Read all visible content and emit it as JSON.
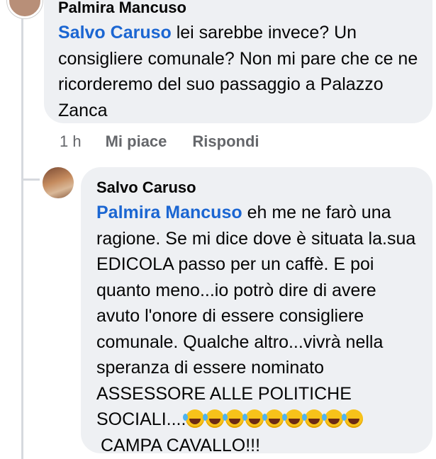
{
  "comment1": {
    "author": "Palmira Mancuso",
    "mention": "Salvo Caruso",
    "text": " lei sarebbe invece? Un consigliere comunale? Non mi pare che ce ne ricorderemo del suo passaggio a Palazzo Zanca",
    "time": "1 h",
    "like_label": "Mi piace",
    "reply_label": "Rispondi"
  },
  "comment2": {
    "author": "Salvo Caruso",
    "mention": "Palmira Mancuso",
    "text": " eh me ne farò una ragione. Se mi dice dove è situata la.sua EDICOLA  passo per un caffè. E poi quanto meno...io potrò dire di avere avuto l'onore di essere consigliere comunale.  Qualche altro...vivrà nella speranza di essere nominato ASSESSORE ALLE POLITICHE SOCIALI....",
    "emoji_name": "rolling-on-floor-laughing-emoji",
    "emoji_count": 9,
    "tail": "CAMPA CAVALLO!!!"
  },
  "colors": {
    "mention": "#1b66d2",
    "bubble": "#eef0f3",
    "meta": "#65676b"
  }
}
